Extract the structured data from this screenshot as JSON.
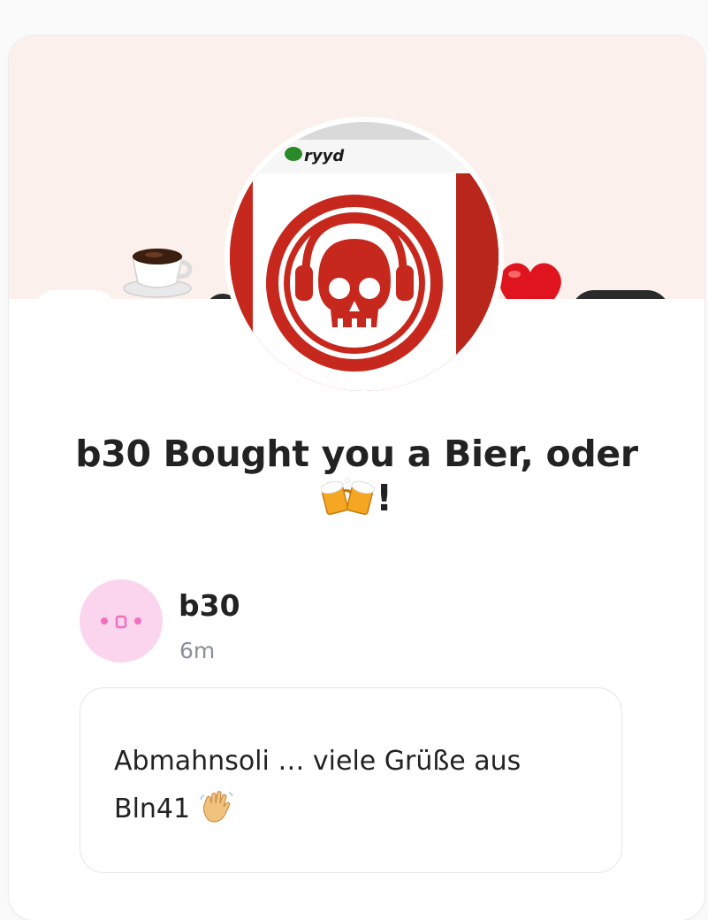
{
  "header": {
    "avatar_logo_text": "ryyd",
    "banner_emojis": [
      "coffee-icon",
      "heart-icon"
    ]
  },
  "title": {
    "text": "b30 Bought you a Bier, oder",
    "suffix": "!",
    "emoji": "beer-mugs-icon"
  },
  "supporter": {
    "name": "b30",
    "time": "6m",
    "avatar_color": "#fbd5ee",
    "avatar_dot_color": "#f06fbf"
  },
  "message": {
    "text": "Abmahnsoli … viele Grüße aus Bln41",
    "emoji": "waving-hand-icon"
  },
  "colors": {
    "banner_bg": "#fbf0ec",
    "skull_red": "#cc2a1f",
    "title_text": "#222222",
    "muted_text": "#8a8f98"
  }
}
